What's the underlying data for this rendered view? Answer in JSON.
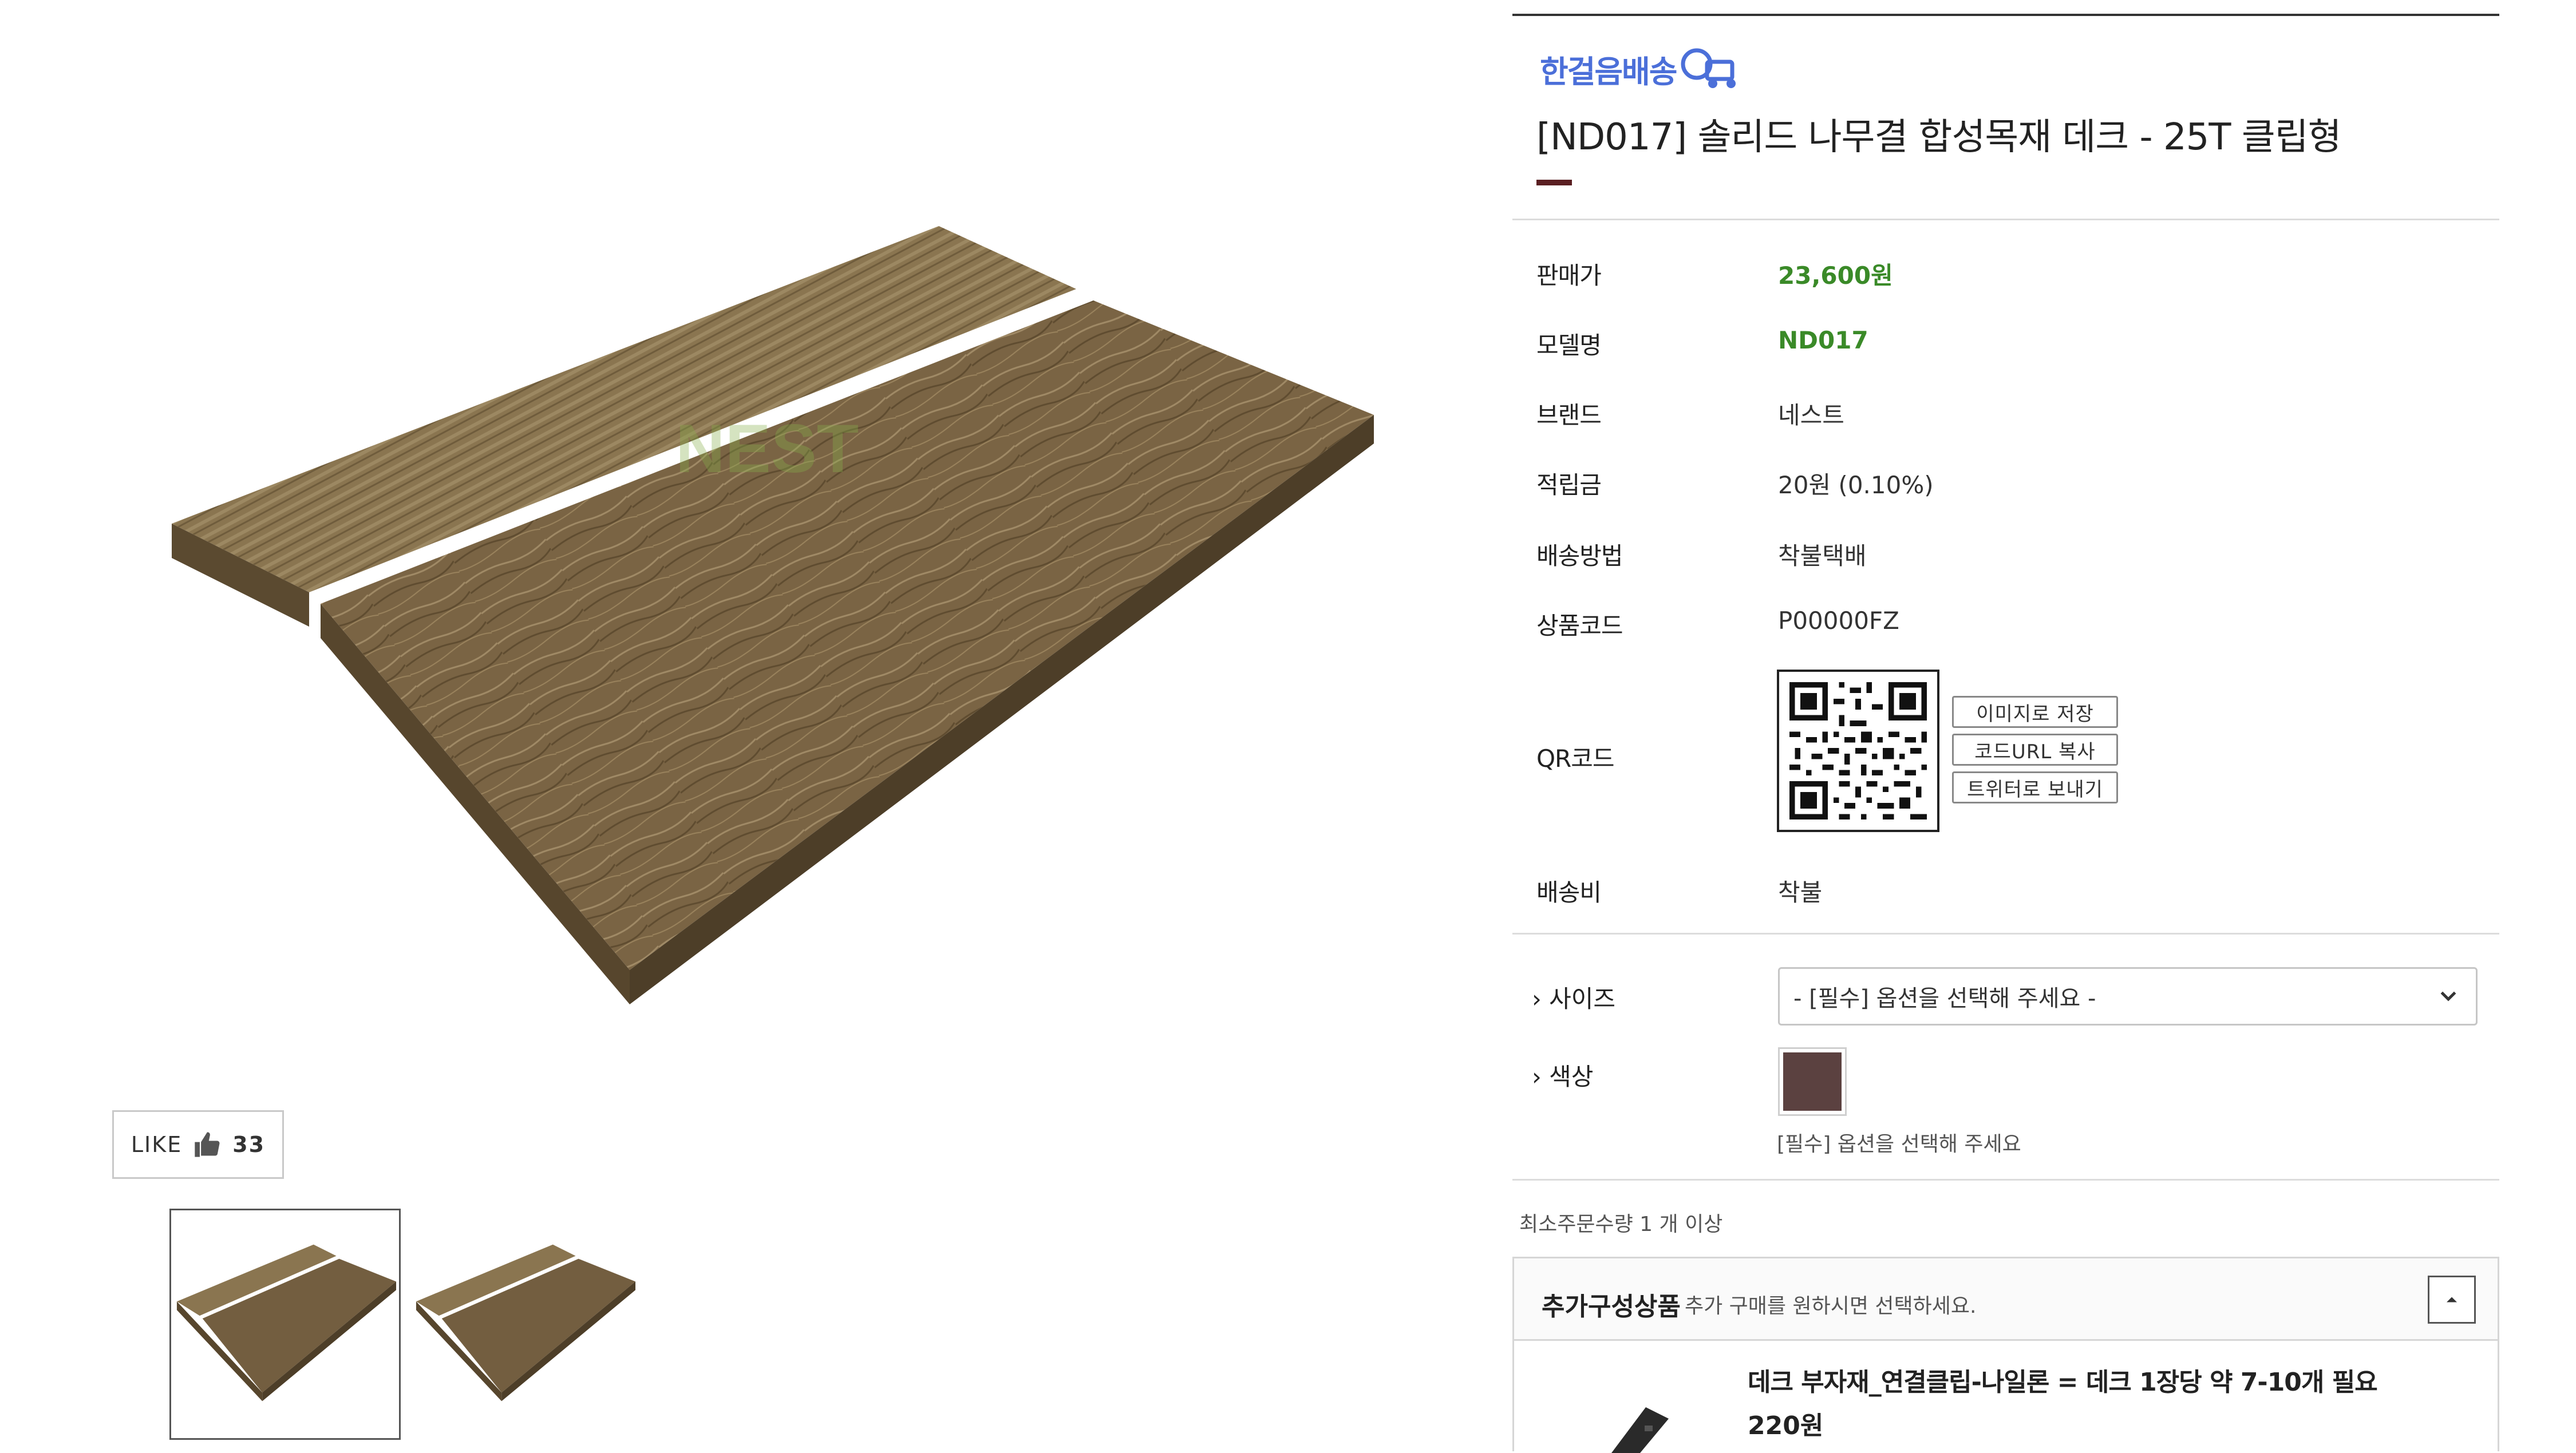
{
  "gallery": {
    "watermark": "NEST",
    "like": {
      "label": "LIKE",
      "count": "33"
    },
    "thumbnails": [
      "thumb-1",
      "thumb-2"
    ]
  },
  "product": {
    "badge": "한걸음배송",
    "title": "[ND017] 솔리드 나무결 합성목재 데크 - 25T 클립형",
    "info": [
      {
        "label": "판매가",
        "value": "23,600원"
      },
      {
        "label": "모델명",
        "value": "ND017"
      },
      {
        "label": "브랜드",
        "value": "네스트"
      },
      {
        "label": "적립금",
        "value": "20원 (0.10%)"
      },
      {
        "label": "배송방법",
        "value": "착불택배"
      },
      {
        "label": "상품코드",
        "value": "P00000FZ"
      },
      {
        "label": "QR코드",
        "value": ""
      },
      {
        "label": "배송비",
        "value": "착불"
      }
    ],
    "qr_buttons": [
      "이미지로 저장",
      "코드URL 복사",
      "트위터로 보내기"
    ]
  },
  "options": {
    "size_label": "› 사이즈",
    "size_placeholder": "- [필수] 옵션을 선택해 주세요 -",
    "color_label": "› 색상",
    "color_swatch": "#5b4140",
    "color_hint": "[필수] 옵션을 선택해 주세요",
    "min_order": "최소주문수량 1 개 이상"
  },
  "addon": {
    "title": "추가구성상품",
    "subtitle": "추가 구매를 원하시면 선택하세요.",
    "item_name": "데크 부자재_연결클립-나일론 = 데크 1장당 약 7-10개 필요",
    "item_price": "220원"
  },
  "colors": {
    "badge_blue": "#4b6fd9",
    "price_green": "#3a8a28",
    "accent": "#5a1f22",
    "wood_light": "#8a7550",
    "wood_dark": "#6e5a3a"
  }
}
